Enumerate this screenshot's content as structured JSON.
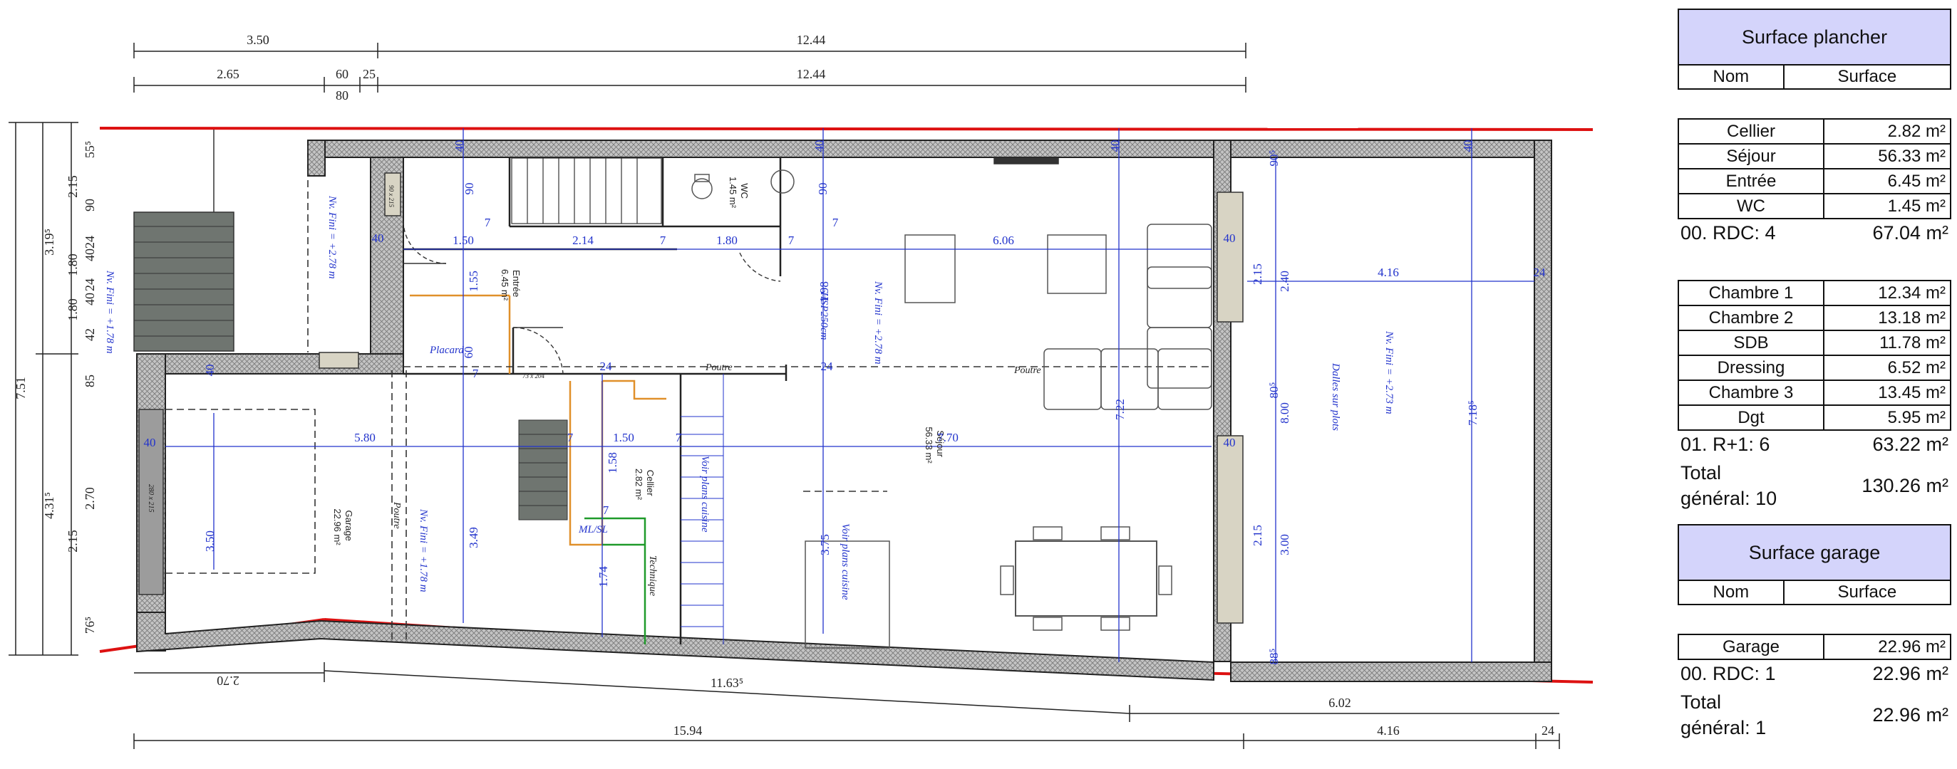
{
  "plan": {
    "top_dims": [
      "3.50",
      "12.44",
      "2.65",
      "60",
      "80",
      "25",
      "12.44"
    ],
    "bottom_dims": [
      "2.70",
      "11.63⁵",
      "6.02",
      "15.94",
      "4.16",
      "24"
    ],
    "left_dims": [
      "7.51",
      "3.19⁵",
      "4.31⁵",
      "55⁵",
      "2.15",
      "90",
      "24",
      "40",
      "24",
      "1.80",
      "40",
      "42",
      "1.80",
      "85",
      "2.70",
      "2.15",
      "76⁵"
    ],
    "inner_dims": [
      "40",
      "40",
      "40",
      "40",
      "40",
      "40",
      "40",
      "40",
      "40",
      "1.50",
      "2.14",
      "7",
      "1.80",
      "7",
      "6.06",
      "90",
      "7",
      "90",
      "7",
      "1.55",
      "1.98",
      "5.80",
      "7",
      "1.50",
      "7",
      "7.70",
      "3.50",
      "3.49",
      "3.75",
      "7.22",
      "1.74",
      "60",
      "7",
      "24",
      "24",
      "1.58",
      "7",
      "4.16",
      "24",
      "7.18⁵",
      "90⁵",
      "2.40",
      "2.15",
      "80⁵",
      "8.00",
      "3.00",
      "2.15",
      "88⁵"
    ],
    "rooms": {
      "entree": {
        "name": "Entrée",
        "area": "6.45 m²"
      },
      "wc": {
        "name": "WC",
        "area": "1.45 m²"
      },
      "sejour": {
        "name": "Séjour",
        "area": "56.33 m²"
      },
      "garage": {
        "name": "Garage",
        "area": "22.96 m²"
      },
      "cellier": {
        "name": "Cellier",
        "area": "2.82 m²"
      }
    },
    "notes": {
      "nv_fini_1": "Nv. Fini = +1.78 m",
      "nv_fini_2": "Nv. Fini = +2.78 m",
      "nv_fini_3": "Nv. Fini = +2.78 m",
      "hsp": "HSP250cm",
      "nv_fini_4": "Nv. Fini = +1.78 m",
      "nv_fini_5": "Nv. Fini = +2.73 m",
      "placard": "Placard",
      "poutre_1": "Poutre",
      "poutre_2": "Poutre",
      "poutre_3": "Poutre",
      "dalles": "Dalles sur plots",
      "voir_1": "Voir plans cuisine",
      "voir_2": "Voir plans cuisine",
      "technique": "Technique",
      "mlsl": "ML/SL",
      "win_small": "90 x 215",
      "win_small_2": "73 x 204",
      "win_garage": "280 x 215"
    }
  },
  "surface_plancher": {
    "title": "Surface plancher",
    "col_nom": "Nom",
    "col_surface": "Surface",
    "rdc_rows": [
      {
        "nom": "Cellier",
        "surface": "2.82 m²"
      },
      {
        "nom": "Séjour",
        "surface": "56.33 m²"
      },
      {
        "nom": "Entrée",
        "surface": "6.45 m²"
      },
      {
        "nom": "WC",
        "surface": "1.45 m²"
      }
    ],
    "rdc_total_label": "00. RDC: 4",
    "rdc_total_value": "67.04 m²",
    "r1_rows": [
      {
        "nom": "Chambre 1",
        "surface": "12.34 m²"
      },
      {
        "nom": "Chambre 2",
        "surface": "13.18 m²"
      },
      {
        "nom": "SDB",
        "surface": "11.78 m²"
      },
      {
        "nom": "Dressing",
        "surface": "6.52 m²"
      },
      {
        "nom": "Chambre 3",
        "surface": "13.45 m²"
      },
      {
        "nom": "Dgt",
        "surface": "5.95 m²"
      }
    ],
    "r1_total_label": "01. R+1: 6",
    "r1_total_value": "63.22 m²",
    "grand_total_label_1": "Total",
    "grand_total_label_2": "général: 10",
    "grand_total_value": "130.26 m²"
  },
  "surface_garage": {
    "title": "Surface garage",
    "col_nom": "Nom",
    "col_surface": "Surface",
    "rows": [
      {
        "nom": "Garage",
        "surface": "22.96 m²"
      }
    ],
    "rdc_total_label": "00. RDC: 1",
    "rdc_total_value": "22.96 m²",
    "grand_total_label_1": "Total",
    "grand_total_label_2": "général: 1",
    "grand_total_value": "22.96 m²"
  },
  "colors": {
    "wall_fill": "#bdbdbd",
    "dimension_blue": "#2233cc",
    "boundary_red": "#dd1111",
    "table_header": "#d4d4fb",
    "stair_fill": "#6f7570",
    "orange": "#e0902a",
    "green": "#1f9a2a"
  }
}
